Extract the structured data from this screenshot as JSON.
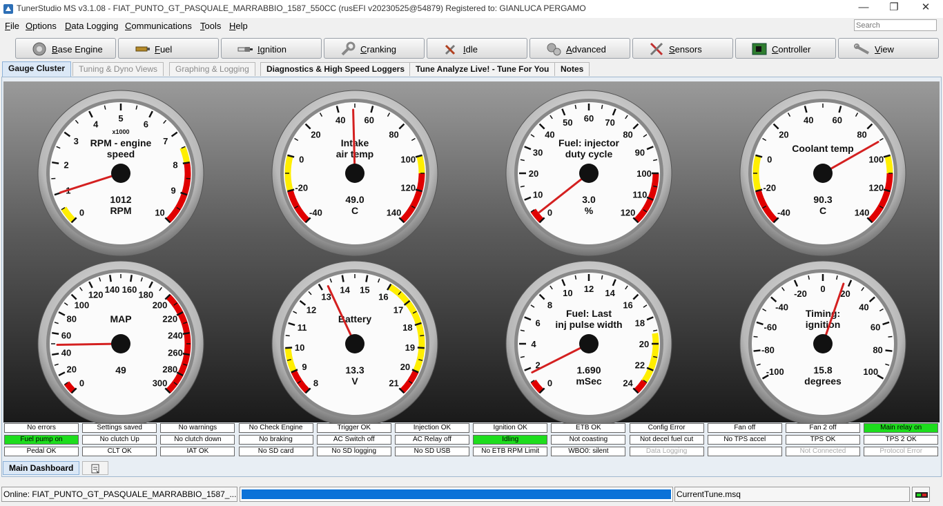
{
  "window": {
    "title": "TunerStudio MS v3.1.08 - FIAT_PUNTO_GT_PASQUALE_MARRABBIO_1587_550CC (rusEFI v20230525@54879) Registered to: GIANLUCA PERGAMO",
    "minimize": "—",
    "restore": "❐",
    "close": "✕"
  },
  "menu": {
    "items": [
      "File",
      "Options",
      "Data Logging",
      "Communications",
      "Tools",
      "Help"
    ],
    "search_placeholder": "Search"
  },
  "toolbar": {
    "buttons": [
      {
        "label": "Base Engine",
        "icon": "engine-icon"
      },
      {
        "label": "Fuel",
        "icon": "fuel-injector-icon"
      },
      {
        "label": "Ignition",
        "icon": "spark-plug-icon"
      },
      {
        "label": "Cranking",
        "icon": "wrench-icon"
      },
      {
        "label": "Idle",
        "icon": "tools-icon"
      },
      {
        "label": "Advanced",
        "icon": "gears-icon"
      },
      {
        "label": "Sensors",
        "icon": "crossed-tools-icon"
      },
      {
        "label": "Controller",
        "icon": "circuit-board-icon"
      },
      {
        "label": "View",
        "icon": "spanner-icon"
      }
    ]
  },
  "tabs": [
    {
      "label": "Gauge Cluster",
      "state": "active"
    },
    {
      "label": "Tuning & Dyno Views",
      "state": "disabled"
    },
    {
      "label": "Graphing & Logging",
      "state": "disabled"
    },
    {
      "label": "Diagnostics & High Speed Loggers",
      "state": "normal"
    },
    {
      "label": "Tune Analyze Live! - Tune For You",
      "state": "normal"
    },
    {
      "label": "Notes",
      "state": "normal"
    }
  ],
  "gauges": [
    {
      "title": [
        "RPM - engine",
        "speed"
      ],
      "min": 0,
      "max": 10,
      "start": -135,
      "sweep": 270,
      "labels": [
        "0",
        "1",
        "2",
        "3",
        "4",
        "5",
        "6",
        "7",
        "8",
        "9",
        "10"
      ],
      "sub": "x1000",
      "value": 1012,
      "value_text": "1012",
      "units": "RPM",
      "needle": 1.012,
      "zones": [
        [
          0,
          0.5,
          "#ffee00"
        ],
        [
          7.5,
          8,
          "#ffee00"
        ],
        [
          8,
          10,
          "#e00000"
        ]
      ]
    },
    {
      "title": [
        "Intake",
        "air temp"
      ],
      "min": -40,
      "max": 140,
      "start": -135,
      "sweep": 270,
      "labels": [
        "-40",
        "-20",
        "0",
        "20",
        "40",
        "60",
        "80",
        "100",
        "120",
        "140"
      ],
      "value": 49.0,
      "value_text": "49.0",
      "units": "C",
      "needle": 49,
      "zones": [
        [
          -40,
          -20,
          "#e00000"
        ],
        [
          -20,
          0,
          "#ffee00"
        ],
        [
          100,
          110,
          "#ffee00"
        ],
        [
          110,
          140,
          "#e00000"
        ]
      ]
    },
    {
      "title": [
        "Fuel: injector",
        "duty cycle"
      ],
      "min": 0,
      "max": 120,
      "start": -135,
      "sweep": 270,
      "labels": [
        "0",
        "10",
        "20",
        "30",
        "40",
        "50",
        "60",
        "70",
        "80",
        "90",
        "100",
        "110",
        "120"
      ],
      "value": 3.0,
      "value_text": "3.0",
      "units": "%",
      "needle": 3,
      "zones": [
        [
          0,
          5,
          "#e00000"
        ],
        [
          100,
          120,
          "#e00000"
        ]
      ]
    },
    {
      "title": [
        "Coolant temp"
      ],
      "min": -40,
      "max": 140,
      "start": -135,
      "sweep": 270,
      "labels": [
        "-40",
        "-20",
        "0",
        "20",
        "40",
        "60",
        "80",
        "100",
        "120",
        "140"
      ],
      "value": 90.3,
      "value_text": "90.3",
      "units": "C",
      "needle": 90.3,
      "zones": [
        [
          -40,
          -20,
          "#e00000"
        ],
        [
          -20,
          0,
          "#ffee00"
        ],
        [
          100,
          110,
          "#ffee00"
        ],
        [
          110,
          140,
          "#e00000"
        ]
      ]
    },
    {
      "title": [
        "MAP"
      ],
      "min": 0,
      "max": 300,
      "start": -135,
      "sweep": 270,
      "labels": [
        "0",
        "20",
        "40",
        "60",
        "80",
        "100",
        "120",
        "140",
        "160",
        "180",
        "200",
        "220",
        "240",
        "260",
        "280",
        "300"
      ],
      "value": 49,
      "value_text": "49",
      "units": "",
      "needle": 49,
      "zones": [
        [
          0,
          10,
          "#e00000"
        ],
        [
          200,
          300,
          "#e00000"
        ]
      ]
    },
    {
      "title": [
        "Battery"
      ],
      "min": 8,
      "max": 21,
      "start": -135,
      "sweep": 270,
      "labels": [
        "8",
        "9",
        "10",
        "11",
        "12",
        "13",
        "14",
        "15",
        "16",
        "17",
        "18",
        "19",
        "20",
        "21"
      ],
      "value": 13.3,
      "value_text": "13.3",
      "units": "V",
      "needle": 13.3,
      "zones": [
        [
          8,
          9,
          "#e00000"
        ],
        [
          9,
          10,
          "#ffee00"
        ],
        [
          16,
          20,
          "#ffee00"
        ],
        [
          20,
          21,
          "#e00000"
        ]
      ]
    },
    {
      "title": [
        "Fuel: Last",
        "inj pulse width"
      ],
      "min": 0,
      "max": 25,
      "start": -135,
      "sweep": 270,
      "labels": [
        "0",
        "2",
        "4",
        "6",
        "8",
        "10",
        "12",
        "14",
        "16",
        "18",
        "20",
        "22",
        "24"
      ],
      "value": 1.69,
      "value_text": "1.690",
      "units": "mSec",
      "needle": 1.69,
      "zones": [
        [
          0,
          1,
          "#e00000"
        ],
        [
          20,
          24,
          "#ffee00"
        ],
        [
          24,
          25,
          "#e00000"
        ]
      ]
    },
    {
      "title": [
        "Timing:",
        "ignition"
      ],
      "min": -100,
      "max": 100,
      "start": -120,
      "sweep": 240,
      "labels": [
        "-100",
        "-80",
        "-60",
        "-40",
        "-20",
        "0",
        "20",
        "40",
        "60",
        "80",
        "100"
      ],
      "value": 15.8,
      "value_text": "15.8",
      "units": "degrees",
      "needle": 15.8,
      "zones": []
    }
  ],
  "indicators": [
    [
      {
        "t": "No errors"
      },
      {
        "t": "Settings saved"
      },
      {
        "t": "No warnings"
      },
      {
        "t": "No Check Engine"
      },
      {
        "t": "Trigger OK"
      },
      {
        "t": "Injection OK"
      },
      {
        "t": "Ignition OK"
      },
      {
        "t": "ETB OK"
      },
      {
        "t": "Config Error"
      },
      {
        "t": "Fan off"
      },
      {
        "t": "Fan 2 off"
      },
      {
        "t": "Main relay on",
        "s": "green"
      }
    ],
    [
      {
        "t": "Fuel pump on",
        "s": "green"
      },
      {
        "t": "No clutch Up"
      },
      {
        "t": "No clutch down"
      },
      {
        "t": "No braking"
      },
      {
        "t": "AC Switch off"
      },
      {
        "t": "AC Relay off"
      },
      {
        "t": "Idling",
        "s": "green"
      },
      {
        "t": "Not coasting"
      },
      {
        "t": "Not decel fuel cut"
      },
      {
        "t": "No TPS accel"
      },
      {
        "t": "TPS OK"
      },
      {
        "t": "TPS 2 OK"
      }
    ],
    [
      {
        "t": "Pedal OK"
      },
      {
        "t": "CLT OK"
      },
      {
        "t": "IAT OK"
      },
      {
        "t": "No SD card"
      },
      {
        "t": "No SD logging"
      },
      {
        "t": "No SD USB"
      },
      {
        "t": "No ETB RPM Limit"
      },
      {
        "t": "WBO0: silent"
      },
      {
        "t": "Data Logging",
        "s": "muted"
      },
      {
        "t": ""
      },
      {
        "t": "Not Connected",
        "s": "muted"
      },
      {
        "t": "Protocol Error",
        "s": "muted"
      }
    ]
  ],
  "bottom_tabs": {
    "main": "Main Dashboard"
  },
  "status": {
    "online": "Online: FIAT_PUNTO_GT_PASQUALE_MARRABBIO_1587_...",
    "progress": 1.0,
    "tune_file": "CurrentTune.msq"
  },
  "colors": {
    "progress": "#0b72d8",
    "indicator_on": "#1ddd1d",
    "needle": "#d42020",
    "danger": "#e00000",
    "warning": "#ffee00"
  }
}
